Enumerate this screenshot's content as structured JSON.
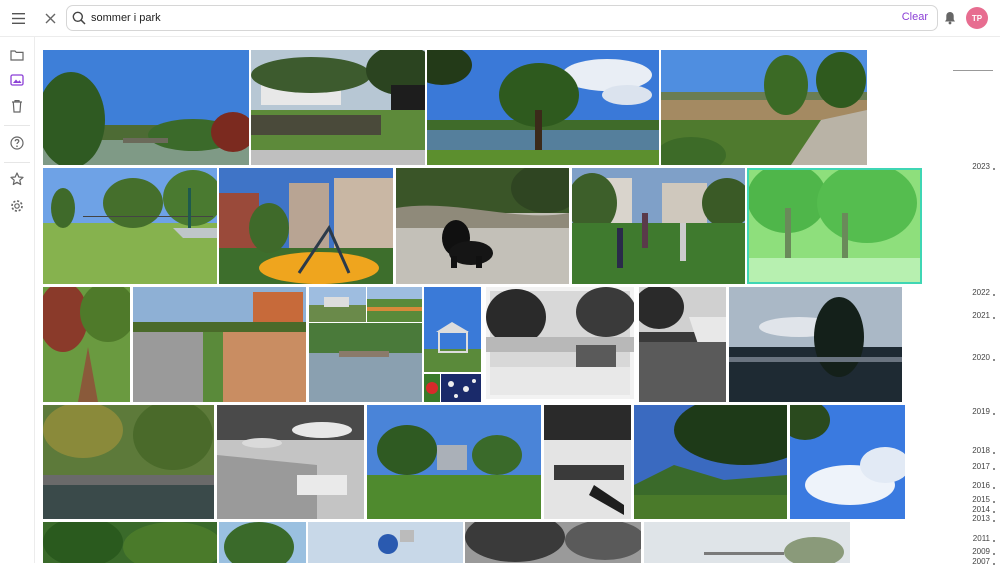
{
  "search": {
    "value": "sommer i park",
    "clear_label": "Clear"
  },
  "user": {
    "initials": "TP",
    "avatar_color": "#e76d90"
  },
  "accent_color": "#8b3fd6",
  "icons": {
    "menu": "menu-icon",
    "close": "close-icon",
    "search": "search-icon",
    "bell": "bell-icon",
    "folder": "folder-icon",
    "photos": "photos-icon",
    "trash": "trash-icon",
    "help": "help-icon",
    "star": "star-icon",
    "settings": "gear-icon"
  },
  "timeline": {
    "years": [
      "2023",
      "2022",
      "2021",
      "2020",
      "2019",
      "2018",
      "2017",
      "2016",
      "2015",
      "2014",
      "2013",
      "2011",
      "2009",
      "2007"
    ]
  }
}
